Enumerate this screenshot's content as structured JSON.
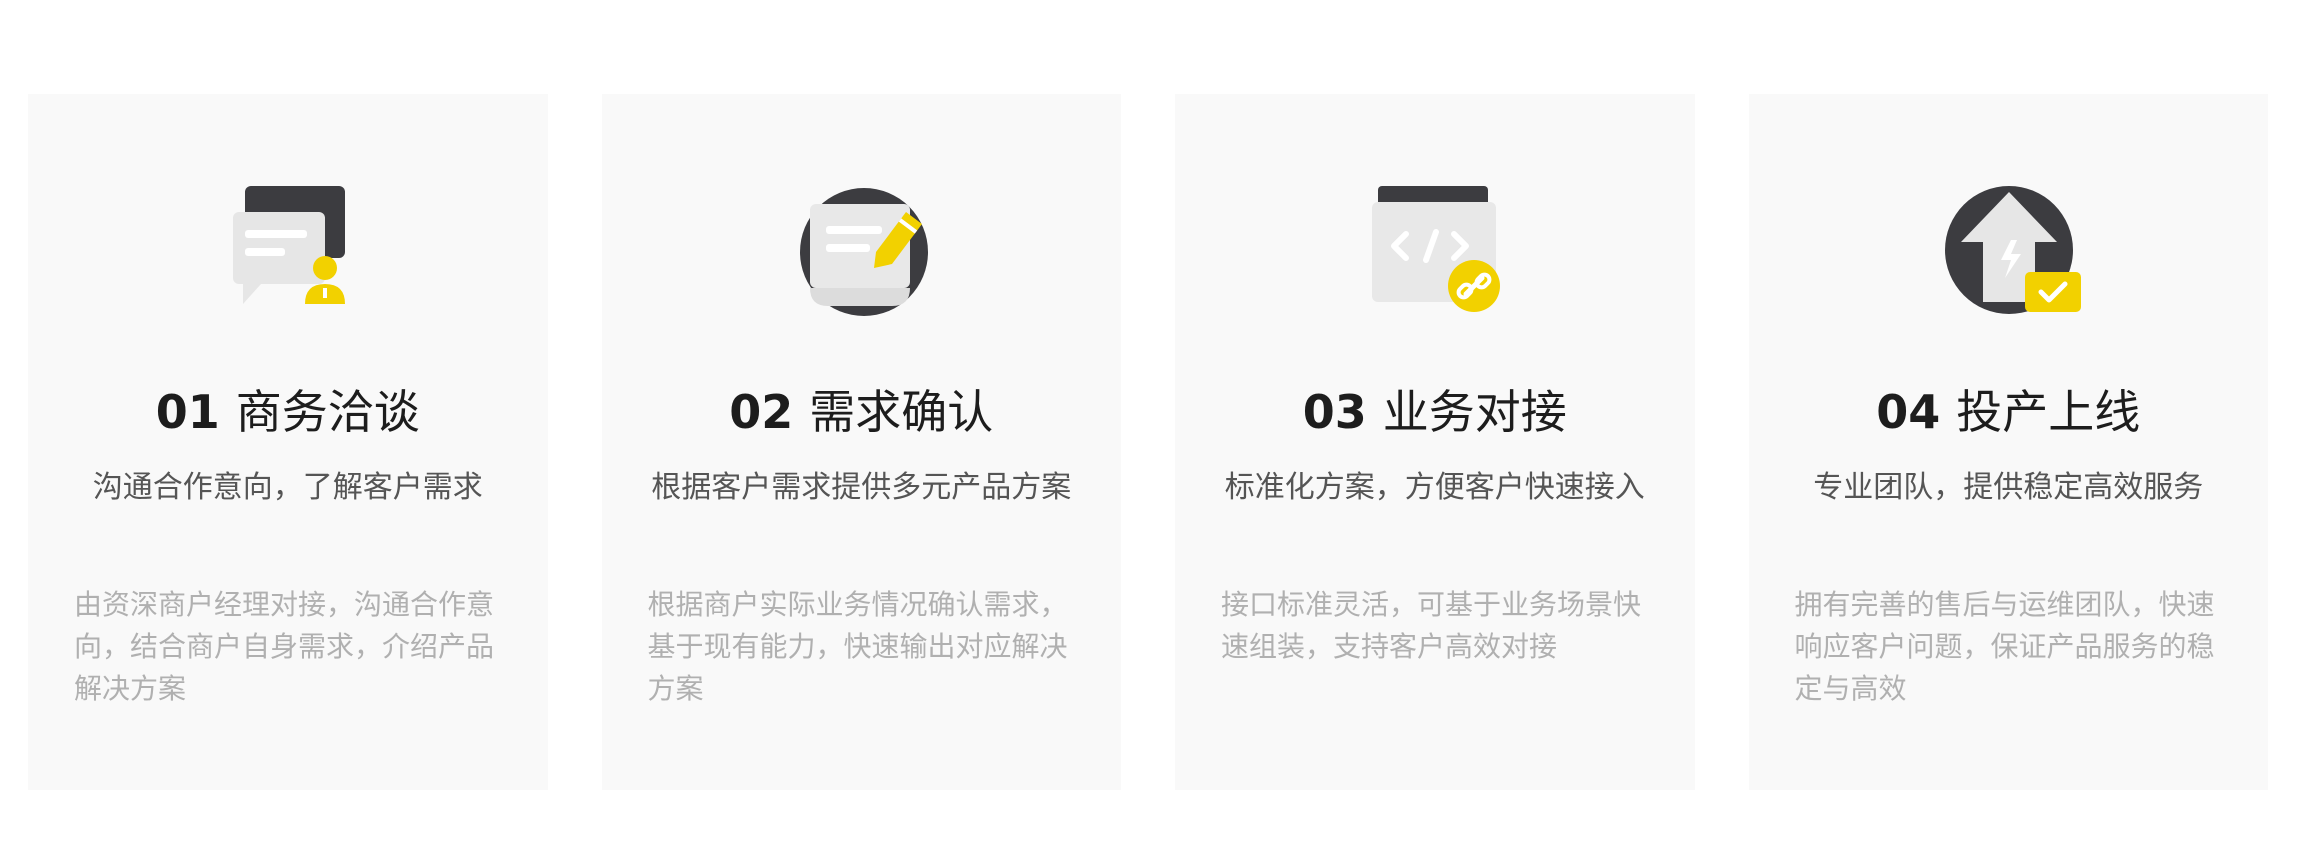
{
  "steps": [
    {
      "number": "01",
      "title": "商务洽谈",
      "subtitle": "沟通合作意向，了解客户需求",
      "description": "由资深商户经理对接，沟通合作意向，结合商户自身需求，介绍产品解决方案",
      "icon": "chat-person-icon"
    },
    {
      "number": "02",
      "title": "需求确认",
      "subtitle": "根据客户需求提供多元产品方案",
      "description": "根据商户实际业务情况确认需求，基于现有能力，快速输出对应解决方案",
      "icon": "document-edit-icon"
    },
    {
      "number": "03",
      "title": "业务对接",
      "subtitle": "标准化方案，方便客户快速接入",
      "description": "接口标准灵活，可基于业务场景快速组装，支持客户高效对接",
      "icon": "code-link-icon"
    },
    {
      "number": "04",
      "title": "投产上线",
      "subtitle": "专业团队，提供稳定高效服务",
      "description": "拥有完善的售后与运维团队，快速响应客户问题，保证产品服务的稳定与高效",
      "icon": "launch-check-icon"
    }
  ],
  "colors": {
    "card_bg": "#f9f9f9",
    "accent": "#f2d100",
    "dark": "#3c3c40",
    "title": "#1d1d1d",
    "subtitle": "#555555",
    "desc": "#b0b0b0"
  }
}
